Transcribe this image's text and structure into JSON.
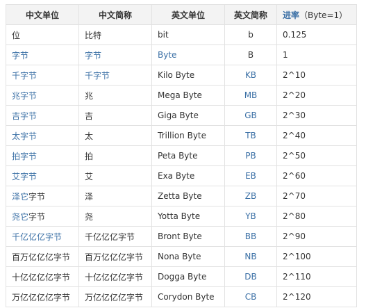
{
  "table": {
    "headers": {
      "cn_unit": "中文单位",
      "cn_abbr": "中文简称",
      "en_unit": "英文单位",
      "en_abbr": "英文简称",
      "base_link": "进率",
      "base_note": "（Byte=1）"
    },
    "rows": [
      {
        "cn_unit": "位",
        "cn_abbr": "比特",
        "en_unit": "bit",
        "en_abbr": "b",
        "base": "0.125"
      },
      {
        "cn_unit": "字节",
        "cn_abbr": "字节",
        "en_unit": "Byte",
        "en_abbr": "B",
        "base": "1"
      },
      {
        "cn_unit": "千字节",
        "cn_abbr": "千字节",
        "en_unit": "Kilo Byte",
        "en_abbr": "KB",
        "base": "2^10"
      },
      {
        "cn_unit": "兆字节",
        "cn_abbr": "兆",
        "en_unit": "Mega Byte",
        "en_abbr": "MB",
        "base": "2^20"
      },
      {
        "cn_unit": "吉字节",
        "cn_abbr": "吉",
        "en_unit": "Giga Byte",
        "en_abbr": "GB",
        "base": "2^30"
      },
      {
        "cn_unit": "太字节",
        "cn_abbr": "太",
        "en_unit": "Trillion Byte",
        "en_abbr": "TB",
        "base": "2^40"
      },
      {
        "cn_unit": "拍字节",
        "cn_abbr": "拍",
        "en_unit": "Peta Byte",
        "en_abbr": "PB",
        "base": "2^50"
      },
      {
        "cn_unit": "艾字节",
        "cn_abbr": "艾",
        "en_unit": "Exa Byte",
        "en_abbr": "EB",
        "base": "2^60"
      },
      {
        "cn_unit": "泽它字节",
        "cn_abbr": "泽",
        "en_unit": "Zetta Byte",
        "en_abbr": "ZB",
        "base": "2^70"
      },
      {
        "cn_unit": "尧它字节",
        "cn_abbr": "尧",
        "en_unit": "Yotta Byte",
        "en_abbr": "YB",
        "base": "2^80"
      },
      {
        "cn_unit": "千亿亿亿字节",
        "cn_abbr": "千亿亿亿字节",
        "en_unit": "Bront Byte",
        "en_abbr": "BB",
        "base": "2^90"
      },
      {
        "cn_unit": "百万亿亿亿字节",
        "cn_abbr": "百万亿亿亿字节",
        "en_unit": "Nona Byte",
        "en_abbr": "NB",
        "base": "2^100"
      },
      {
        "cn_unit": "十亿亿亿亿字节",
        "cn_abbr": "十亿亿亿亿字节",
        "en_unit": "Dogga Byte",
        "en_abbr": "DB",
        "base": "2^110"
      },
      {
        "cn_unit": "万亿亿亿亿字节",
        "cn_abbr": "万亿亿亿亿字节",
        "en_unit": "Corydon Byte",
        "en_abbr": "CB",
        "base": "2^120"
      }
    ]
  },
  "colors": {
    "link": "#3a6fa5",
    "text": "#333333",
    "header_bg": "#f3f3f3",
    "border": "#e2e2e2"
  }
}
